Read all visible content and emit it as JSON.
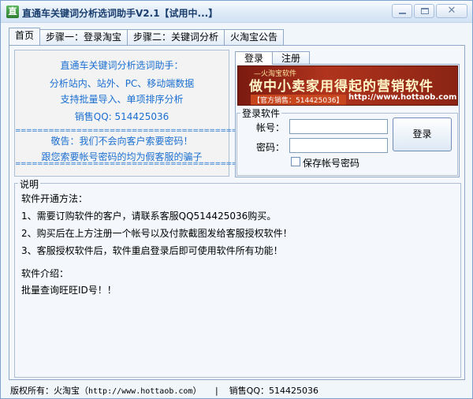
{
  "window": {
    "title": "直通车关键词分析选词助手V2.1【试用中...】",
    "app_icon": "app-icon",
    "controls": [
      "minimize-icon",
      "maximize-icon",
      "close-icon"
    ]
  },
  "tabs": [
    {
      "label": "首页",
      "active": true
    },
    {
      "label": "步骤一：登录淘宝",
      "active": false
    },
    {
      "label": "步骤二：关键词分析",
      "active": false
    },
    {
      "label": "火淘宝公告",
      "active": false
    }
  ],
  "info": {
    "line1": "直通车关键词分析选词助手：",
    "line2": "分析站内、站外、PC、移动端数据",
    "line3": "支持批量导入、单项排序分析",
    "line4": "销售QQ: 514425036",
    "separator": "==============================================",
    "line5": "敬告：我们不会向客户索要密码！",
    "line6": "跟您索要帐号密码的均为假客服的骗子",
    "color": "#1b6fd2"
  },
  "login": {
    "tabs": [
      {
        "label": "登录",
        "active": true
      },
      {
        "label": "注册",
        "active": false
      }
    ],
    "banner": {
      "soft": "—火淘宝软件",
      "slogan": "做中小卖家用得起的营销软件",
      "sales": "【官方销售：514425036】",
      "url": "http://www.hottaob.com"
    },
    "group_label": "登录软件",
    "account_label": "帐号：",
    "account_value": "",
    "password_label": "密码：",
    "password_value": "",
    "login_button": "登录",
    "remember_label": "保存帐号密码",
    "remember_checked": false
  },
  "description": {
    "legend": "说明",
    "lines": [
      "软件开通方法：",
      "1、需要订购软件的客户，请联系客服QQ514425036购买。",
      "2、购买后在上方注册一个帐号以及付款截图发给客服授权软件！",
      "3、客服授权软件后，软件重启登录后即可使用软件所有功能！",
      "软件介绍：",
      "批量查询旺旺ID号！！"
    ]
  },
  "status": {
    "copyright": "版权所有：火淘宝（",
    "url": "http://www.hottaob.com",
    "copyright_end": "）",
    "divider": "|",
    "qq": "销售QQ：514425036"
  }
}
